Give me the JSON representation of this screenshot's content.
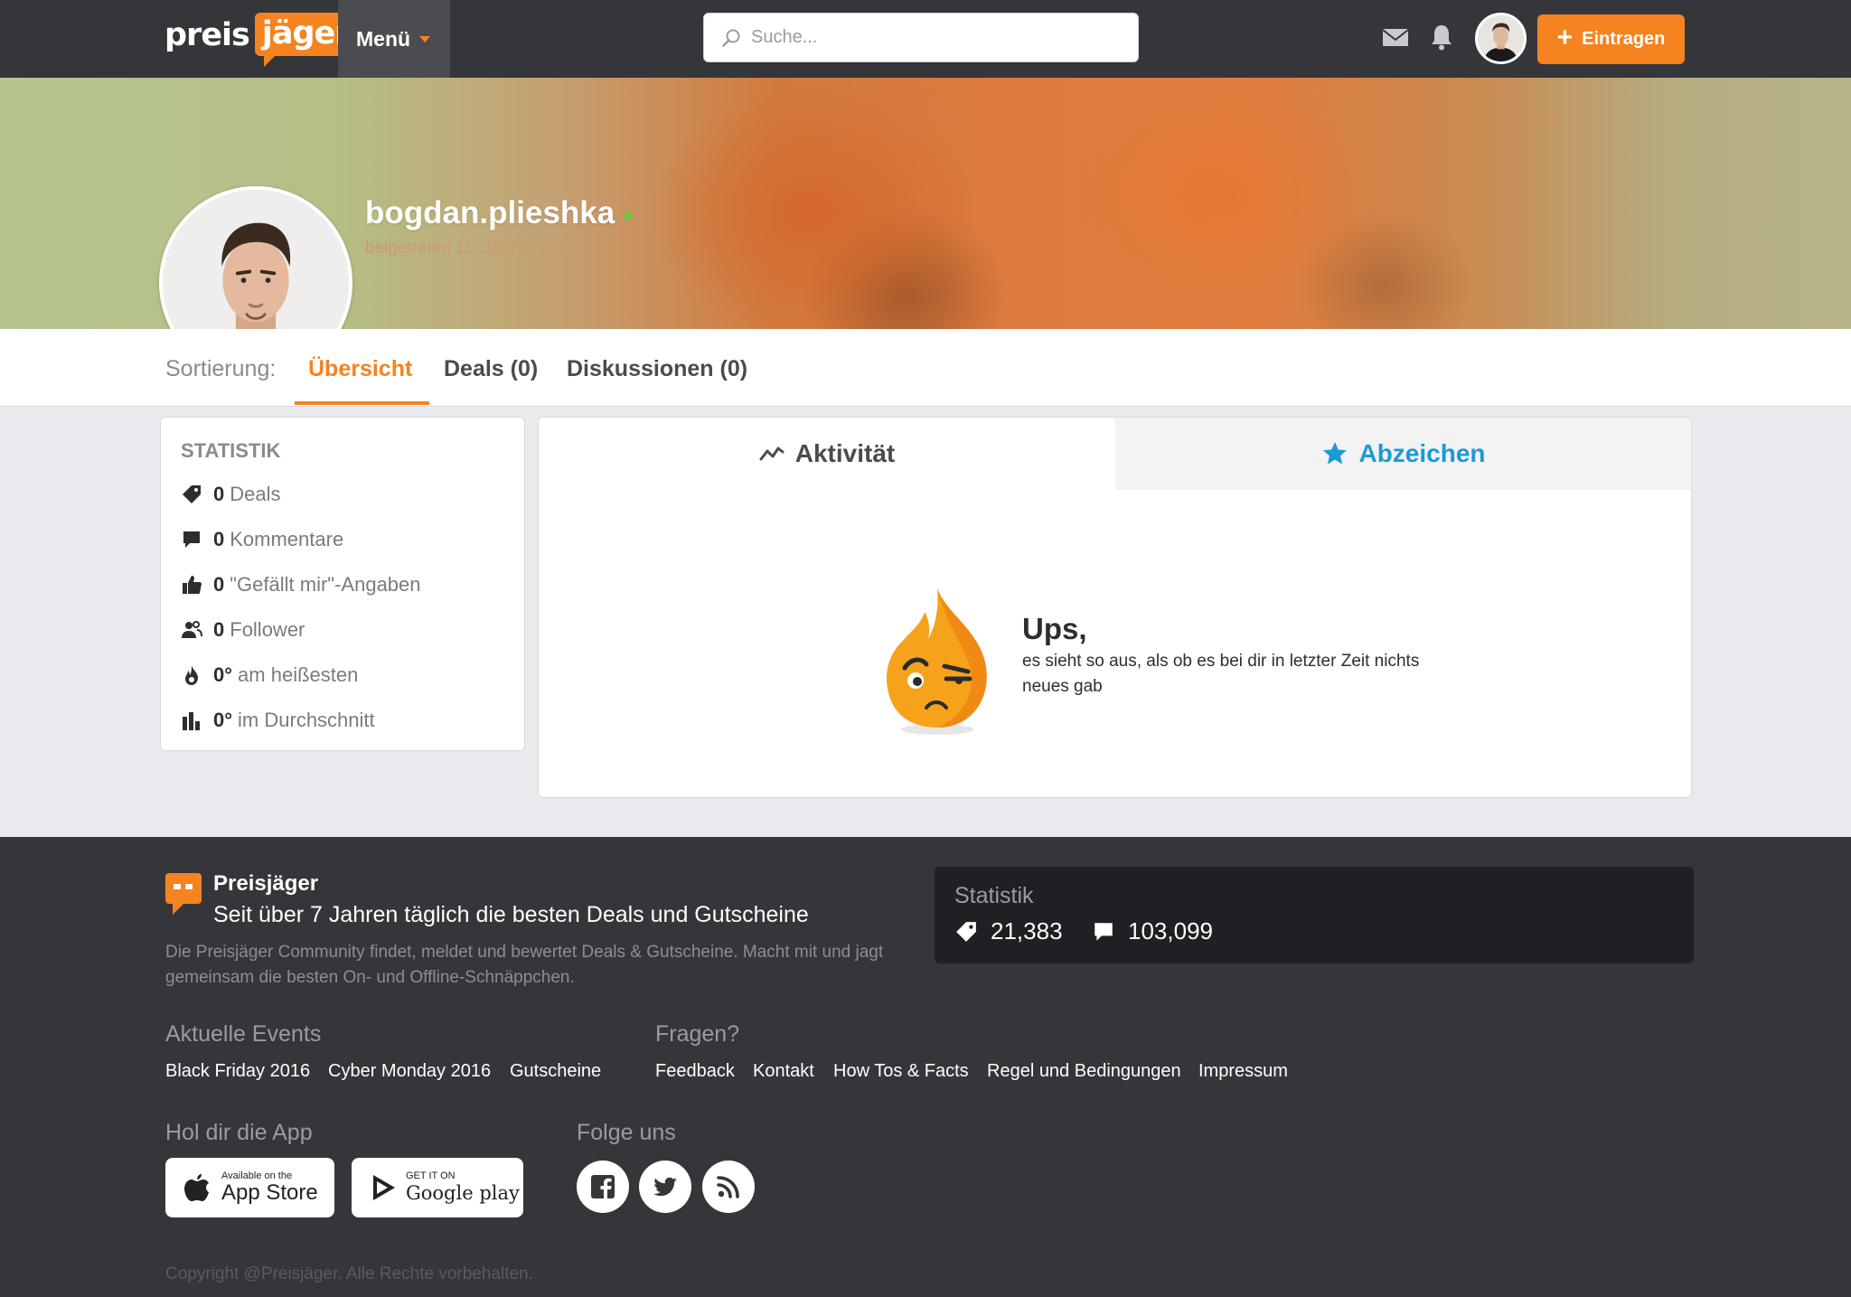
{
  "header": {
    "logo_part1": "preis",
    "logo_part2": "jäger",
    "menu_label": "Menü",
    "search_placeholder": "Suche...",
    "add_button_label": "Eintragen"
  },
  "profile": {
    "username": "bogdan.plieshka",
    "joined": "beigetreten 11. Jänner 2016"
  },
  "sort": {
    "label": "Sortierung:",
    "tabs": [
      {
        "label": "Übersicht",
        "active": true
      },
      {
        "label": "Deals (0)",
        "active": false
      },
      {
        "label": "Diskussionen (0)",
        "active": false
      }
    ]
  },
  "stats": {
    "title": "STATISTIK",
    "items": [
      {
        "icon": "tag-icon",
        "value": "0",
        "label": "Deals"
      },
      {
        "icon": "comment-icon",
        "value": "0",
        "label": "Kommentare"
      },
      {
        "icon": "thumbs-up-icon",
        "value": "0",
        "label": "\"Gefällt mir\"-Angaben"
      },
      {
        "icon": "followers-icon",
        "value": "0",
        "label": "Follower"
      },
      {
        "icon": "flame-icon",
        "value": "0°",
        "label": "am heißesten"
      },
      {
        "icon": "bar-chart-icon",
        "value": "0°",
        "label": "im Durchschnitt"
      }
    ]
  },
  "activity": {
    "tab_activity": "Aktivität",
    "tab_badges": "Abzeichen",
    "empty_title": "Ups,",
    "empty_text": "es sieht so aus, als ob es bei dir in letzter Zeit nichts neues gab"
  },
  "footer": {
    "brand": "Preisjäger",
    "tagline": "Seit über 7 Jahren täglich die besten Deals und Gutscheine",
    "description": "Die Preisjäger Community findet, meldet und bewertet Deals & Gutscheine. Macht mit und jagt gemeinsam die besten On- und Offline-Schnäppchen.",
    "stat_title": "Statistik",
    "stat_deals": "21,383",
    "stat_comments": "103,099",
    "events_heading": "Aktuelle Events",
    "events": [
      "Black Friday 2016",
      "Cyber Monday 2016",
      "Gutscheine"
    ],
    "questions_heading": "Fragen?",
    "questions": [
      "Feedback",
      "Kontakt",
      "How Tos & Facts",
      "Regel und Bedingungen",
      "Impressum"
    ],
    "app_heading": "Hol dir die App",
    "appstore_small": "Available on the",
    "appstore_big": "App Store",
    "googleplay_small": "GET IT ON",
    "googleplay_big": "Google play",
    "follow_heading": "Folge uns",
    "copyright": "Copyright @Preisjäger. Alle Rechte vorbehalten."
  },
  "colors": {
    "brand_orange": "#f58320",
    "badge_blue": "#1b9ad6",
    "online_green": "#7ac143",
    "topbar": "#35363a"
  }
}
